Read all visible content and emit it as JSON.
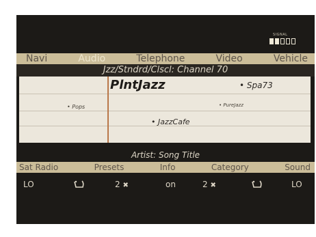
{
  "signal": {
    "label": "SIGNAL",
    "bars_total": 5,
    "bars_on": 2
  },
  "topnav": {
    "items": [
      {
        "label": "Navi"
      },
      {
        "label": "Audio"
      },
      {
        "label": "Telephone"
      },
      {
        "label": "Video"
      },
      {
        "label": "Vehicle"
      }
    ],
    "active": "Audio"
  },
  "channel": {
    "title": "Jzz/Stndrd/Clscl: Channel 70"
  },
  "grid": {
    "main": "PlntJazz",
    "top_right": "• Spa73",
    "left_middle": "• Pops",
    "right_middle": "• PureJazz",
    "bottom": "• JazzCafe"
  },
  "artist": {
    "text": "Artist: Song Title"
  },
  "botnav": {
    "items": [
      {
        "label": "Sat Radio"
      },
      {
        "label": "Presets"
      },
      {
        "label": "Info"
      },
      {
        "label": "Category"
      },
      {
        "label": "Sound"
      }
    ]
  },
  "status": {
    "left": "LO",
    "presets": "2",
    "info": "on",
    "category": "2",
    "right": "LO"
  },
  "colors": {
    "bar": "#cbbd99",
    "screen": "#1c1a17",
    "grid": "#ece7dc",
    "accent_line": "#b97749"
  }
}
